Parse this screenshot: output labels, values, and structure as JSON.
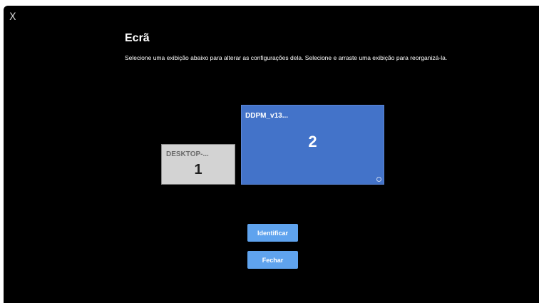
{
  "header": {
    "close_glyph": "X",
    "title": "Ecrã",
    "description": "Selecione uma exibição abaixo para alterar as configurações dela. Selecione e arraste uma exibição para reorganizá-la."
  },
  "displays": [
    {
      "name": "DESKTOP-...",
      "number": "1",
      "selected": false,
      "color": "#d3d3d3"
    },
    {
      "name": "DDPM_v13...",
      "number": "2",
      "selected": true,
      "color": "#4373c9",
      "icon": "gear-icon"
    }
  ],
  "buttons": {
    "identify_label": "Identificar",
    "close_label": "Fechar",
    "color": "#5fa3ee"
  }
}
